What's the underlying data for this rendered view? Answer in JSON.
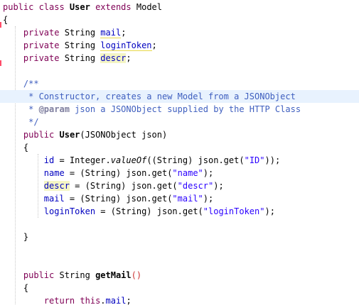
{
  "editor": {
    "lines": [
      [
        {
          "t": "public class ",
          "c": "kw"
        },
        {
          "t": "User",
          "c": "bold"
        },
        {
          "t": " "
        },
        {
          "t": "extends",
          "c": "kw"
        },
        {
          "t": " Model"
        }
      ],
      [
        {
          "t": "{"
        }
      ],
      [
        {
          "t": "    "
        },
        {
          "t": "private",
          "c": "kw"
        },
        {
          "t": " String "
        },
        {
          "t": "mail",
          "c": "field warn-u"
        },
        {
          "t": ";"
        }
      ],
      [
        {
          "t": "    "
        },
        {
          "t": "private",
          "c": "kw"
        },
        {
          "t": " String "
        },
        {
          "t": "loginToken",
          "c": "field warn-u"
        },
        {
          "t": ";"
        }
      ],
      [
        {
          "t": "    "
        },
        {
          "t": "private",
          "c": "kw"
        },
        {
          "t": " String "
        },
        {
          "t": "descr",
          "c": "field warn"
        },
        {
          "t": ";"
        }
      ],
      [],
      [
        {
          "t": "    "
        },
        {
          "t": "/**",
          "c": "com"
        }
      ],
      [
        {
          "t": "     * Constructor, creates a new Model from a JSONObject",
          "c": "com"
        }
      ],
      [
        {
          "t": "     * ",
          "c": "com"
        },
        {
          "t": "@param",
          "c": "tag"
        },
        {
          "t": " json a JSONObject supplied by the HTTP Class",
          "c": "com"
        }
      ],
      [
        {
          "t": "     */",
          "c": "com"
        }
      ],
      [
        {
          "t": "    "
        },
        {
          "t": "public",
          "c": "kw"
        },
        {
          "t": " "
        },
        {
          "t": "User",
          "c": "bold"
        },
        {
          "t": "(JSONObject json)"
        }
      ],
      [
        {
          "t": "    {"
        }
      ],
      [
        {
          "t": "        "
        },
        {
          "t": "id",
          "c": "field"
        },
        {
          "t": " = Integer."
        },
        {
          "t": "valueOf",
          "c": "italic"
        },
        {
          "t": "((String) json.get("
        },
        {
          "t": "\"ID\"",
          "c": "str"
        },
        {
          "t": "));"
        }
      ],
      [
        {
          "t": "        "
        },
        {
          "t": "name",
          "c": "field"
        },
        {
          "t": " = (String) json.get("
        },
        {
          "t": "\"name\"",
          "c": "str"
        },
        {
          "t": ");"
        }
      ],
      [
        {
          "t": "        "
        },
        {
          "t": "descr",
          "c": "field warn"
        },
        {
          "t": " = (String) json.get("
        },
        {
          "t": "\"descr\"",
          "c": "str"
        },
        {
          "t": ");"
        }
      ],
      [
        {
          "t": "        "
        },
        {
          "t": "mail",
          "c": "field"
        },
        {
          "t": " = (String) json.get("
        },
        {
          "t": "\"mail\"",
          "c": "str"
        },
        {
          "t": ");"
        }
      ],
      [
        {
          "t": "        "
        },
        {
          "t": "loginToken",
          "c": "field"
        },
        {
          "t": " = (String) json.get("
        },
        {
          "t": "\"loginToken\"",
          "c": "str"
        },
        {
          "t": ");"
        }
      ],
      [],
      [
        {
          "t": "    }"
        }
      ],
      [],
      [],
      [
        {
          "t": "    "
        },
        {
          "t": "public",
          "c": "kw"
        },
        {
          "t": " String "
        },
        {
          "t": "getMail",
          "c": "bold"
        },
        {
          "t": "()",
          "c": "paren"
        }
      ],
      [
        {
          "t": "    {"
        }
      ],
      [
        {
          "t": "        "
        },
        {
          "t": "return",
          "c": "kw"
        },
        {
          "t": " "
        },
        {
          "t": "this",
          "c": "kw"
        },
        {
          "t": "."
        },
        {
          "t": "mail",
          "c": "field"
        },
        {
          "t": ";"
        }
      ],
      [
        {
          "t": "    }"
        }
      ]
    ],
    "current_line": 7
  }
}
